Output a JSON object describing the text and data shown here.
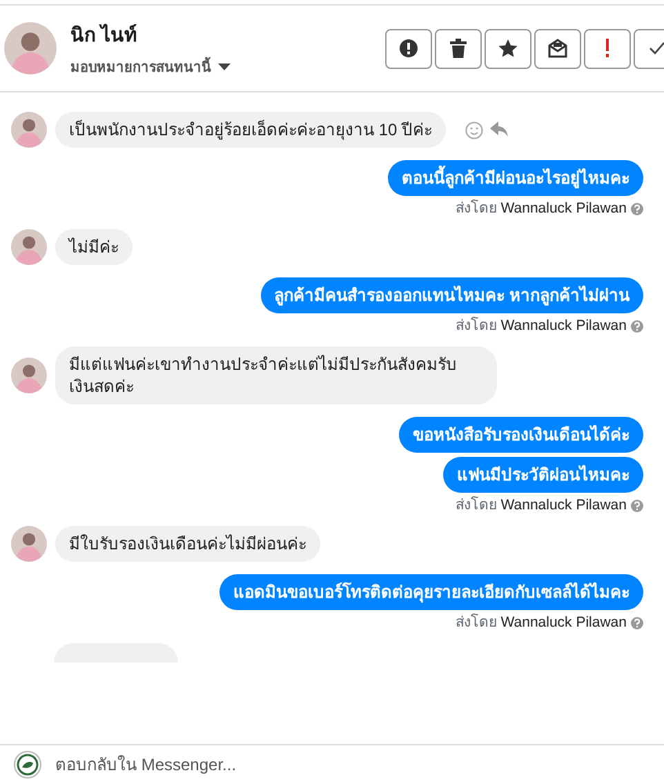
{
  "contact": {
    "name": "นิก ไนท์",
    "assign_label": "มอบหมายการสนทนานี้"
  },
  "messages": [
    {
      "kind": "incoming",
      "text": "เป็นพนักงานประจำอยู่ร้อยเอ็ดค่ะค่ะอายุงาน 10 ปีค่ะ",
      "show_actions": true
    },
    {
      "kind": "outgoing",
      "text": "ตอนนี้ลูกค้ามีผ่อนอะไรอยู่ไหมคะ"
    },
    {
      "kind": "sent_by",
      "label": "ส่งโดย",
      "name": "Wannaluck Pilawan"
    },
    {
      "kind": "incoming",
      "text": "ไม่มีค่ะ",
      "show_actions": false
    },
    {
      "kind": "outgoing",
      "text": "ลูกค้ามีคนสำรองออกแทนไหมคะ  หากลูกค้าไม่ผ่าน"
    },
    {
      "kind": "sent_by",
      "label": "ส่งโดย",
      "name": "Wannaluck Pilawan"
    },
    {
      "kind": "incoming",
      "text": "มีแต่แฟนค่ะเขาทำงานประจำค่ะแต่ไม่มีประกันสังคมรับเงินสดค่ะ",
      "show_actions": false
    },
    {
      "kind": "outgoing",
      "text": "ขอหนังสือรับรองเงินเดือนได้ค่ะ"
    },
    {
      "kind": "outgoing",
      "text": "แฟนมีประวัติผ่อนไหมคะ"
    },
    {
      "kind": "sent_by",
      "label": "ส่งโดย",
      "name": "Wannaluck Pilawan"
    },
    {
      "kind": "incoming",
      "text": "มีใบรับรองเงินเดือนค่ะไม่มีผ่อนค่ะ",
      "show_actions": false
    },
    {
      "kind": "outgoing",
      "text": "แอดมินขอเบอร์โทรติดต่อคุยรายละเอียดกับเซลล์ได้ไมคะ"
    },
    {
      "kind": "sent_by",
      "label": "ส่งโดย",
      "name": "Wannaluck Pilawan"
    }
  ],
  "composer": {
    "placeholder": "ตอบกลับใน Messenger..."
  }
}
